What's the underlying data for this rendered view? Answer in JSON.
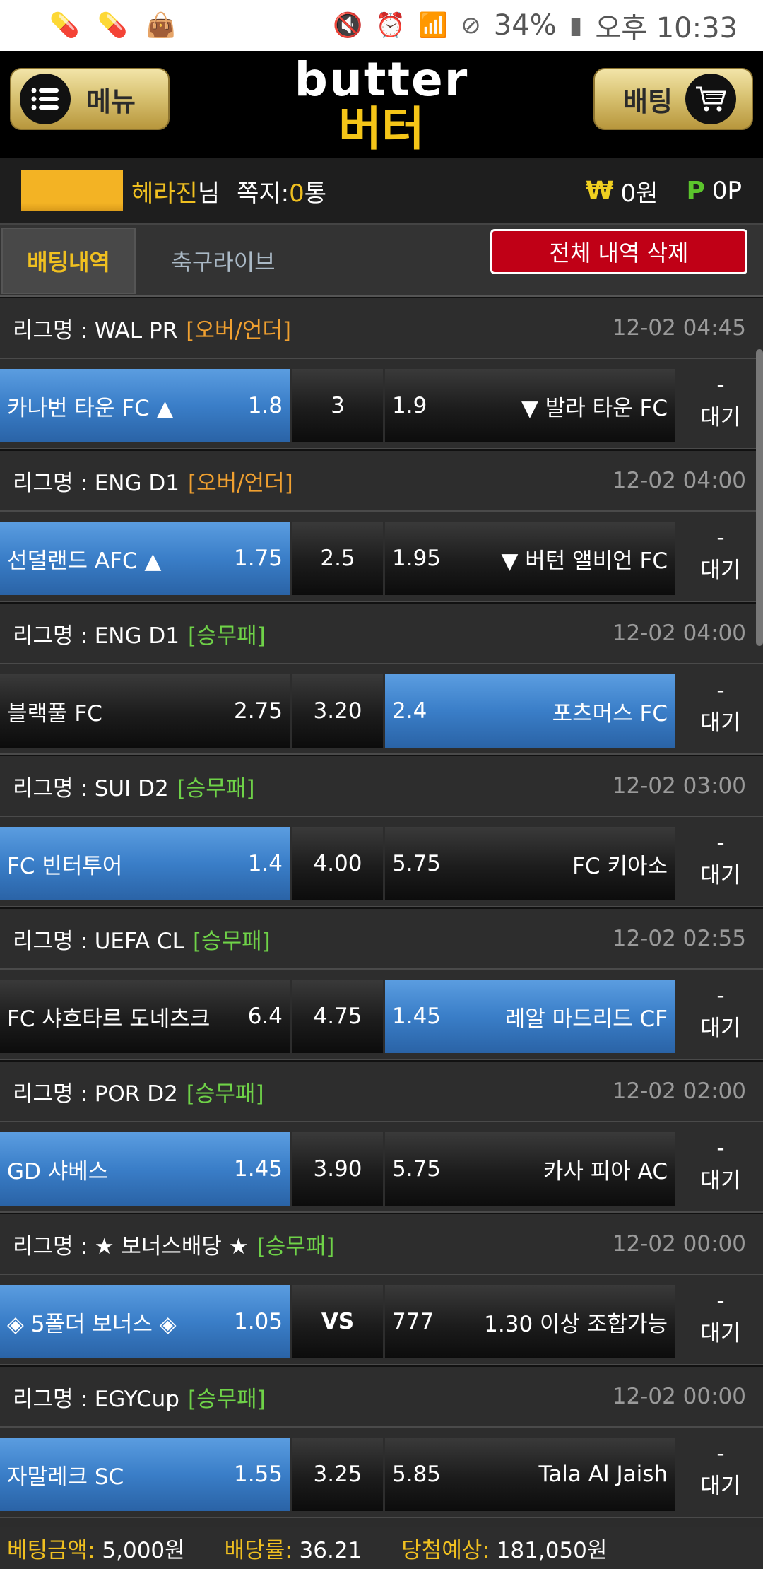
{
  "status": {
    "battery": "34%",
    "time": "오후 10:33"
  },
  "header": {
    "menu_label": "메뉴",
    "bet_label": "배팅",
    "logo_en": "butter",
    "logo_ko": "버터"
  },
  "user": {
    "name": "헤라진",
    "suffix": "님",
    "msg_label": "쪽지:",
    "msg_count": "0",
    "msg_unit": "통",
    "won_symbol": "₩",
    "won": "0원",
    "point_symbol": "P",
    "points": "0P"
  },
  "tabs": {
    "active": "배팅내역",
    "other": "축구라이브",
    "delete_all": "전체 내역 삭제"
  },
  "bets": [
    {
      "league": "리그명 : WAL PR",
      "tag": "[오버/언더]",
      "tag_type": "ou",
      "time": "12-02 04:45",
      "home": "카나번 타운 FC ▲",
      "home_odds": "1.8",
      "mid": "3",
      "away_odds": "1.9",
      "away": "▼ 발라 타운 FC",
      "selected": "home",
      "result_top": "-",
      "result": "대기"
    },
    {
      "league": "리그명 : ENG D1",
      "tag": "[오버/언더]",
      "tag_type": "ou",
      "time": "12-02 04:00",
      "home": "선덜랜드 AFC ▲",
      "home_odds": "1.75",
      "mid": "2.5",
      "away_odds": "1.95",
      "away": "▼ 버턴 앨비언 FC",
      "selected": "home",
      "result_top": "-",
      "result": "대기"
    },
    {
      "league": "리그명 : ENG D1",
      "tag": "[승무패]",
      "tag_type": "wdl",
      "time": "12-02 04:00",
      "home": "블랙풀 FC",
      "home_odds": "2.75",
      "mid": "3.20",
      "away_odds": "2.4",
      "away": "포츠머스 FC",
      "selected": "away",
      "result_top": "-",
      "result": "대기"
    },
    {
      "league": "리그명 : SUI D2",
      "tag": "[승무패]",
      "tag_type": "wdl",
      "time": "12-02 03:00",
      "home": "FC 빈터투어",
      "home_odds": "1.4",
      "mid": "4.00",
      "away_odds": "5.75",
      "away": "FC 키아소",
      "selected": "home",
      "result_top": "-",
      "result": "대기"
    },
    {
      "league": "리그명 : UEFA CL",
      "tag": "[승무패]",
      "tag_type": "wdl",
      "time": "12-02 02:55",
      "home": "FC 샤흐타르 도네츠크",
      "home_odds": "6.4",
      "mid": "4.75",
      "away_odds": "1.45",
      "away": "레알 마드리드 CF",
      "selected": "away",
      "result_top": "-",
      "result": "대기"
    },
    {
      "league": "리그명 : POR D2",
      "tag": "[승무패]",
      "tag_type": "wdl",
      "time": "12-02 02:00",
      "home": "GD 샤베스",
      "home_odds": "1.45",
      "mid": "3.90",
      "away_odds": "5.75",
      "away": "카사 피아 AC",
      "selected": "home",
      "result_top": "-",
      "result": "대기"
    },
    {
      "league": "리그명 : ★ 보너스배당 ★",
      "tag": "[승무패]",
      "tag_type": "wdl",
      "time": "12-02 00:00",
      "home": "◈ 5폴더 보너스 ◈",
      "home_odds": "1.05",
      "mid": "VS",
      "away_odds": "777",
      "away": "1.30 이상 조합가능",
      "selected": "home",
      "result_top": "-",
      "result": "대기"
    },
    {
      "league": "리그명 : EGYCup",
      "tag": "[승무패]",
      "tag_type": "wdl",
      "time": "12-02 00:00",
      "home": "자말레크 SC",
      "home_odds": "1.55",
      "mid": "3.25",
      "away_odds": "5.85",
      "away": "Tala Al Jaish",
      "selected": "home",
      "result_top": "-",
      "result": "대기"
    }
  ],
  "footer": {
    "amount_label": "베팅금액:",
    "amount": "5,000원",
    "rate_label": "배당률:",
    "rate": "36.21",
    "expected_label": "당첨예상:",
    "expected": "181,050원"
  }
}
